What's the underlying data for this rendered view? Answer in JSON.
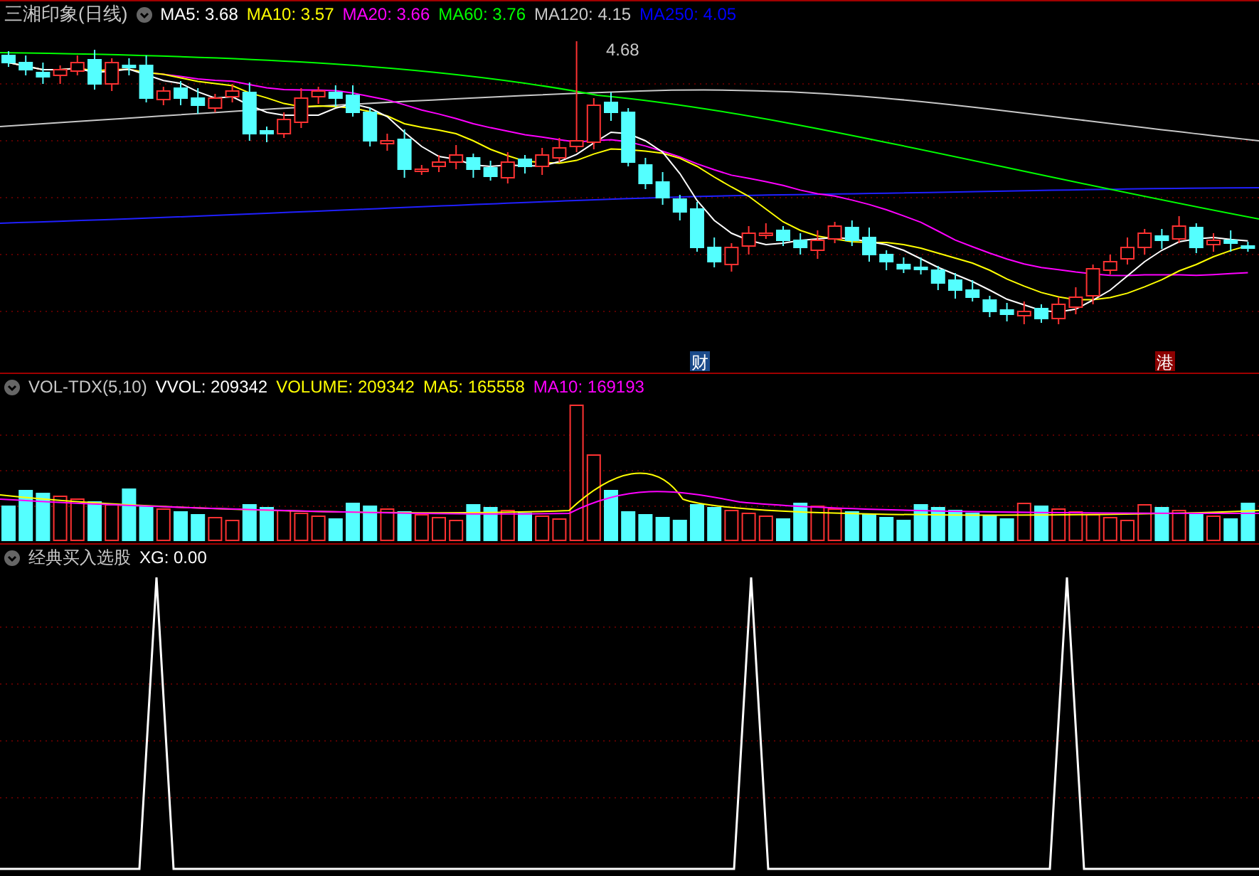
{
  "price_panel": {
    "title": "三湘印象(日线)",
    "indicators": [
      {
        "label": "MA5: 3.68",
        "color": "#ffffff"
      },
      {
        "label": "MA10: 3.57",
        "color": "#ffff00"
      },
      {
        "label": "MA20: 3.66",
        "color": "#ff00ff"
      },
      {
        "label": "MA60: 3.76",
        "color": "#00ff00"
      },
      {
        "label": "MA120: 4.15",
        "color": "#c8c8c8"
      },
      {
        "label": "MA250: 4.05",
        "color": "#0000ff"
      }
    ],
    "high_marker": "4.68",
    "event_badges": [
      {
        "text": "财",
        "color": "#1a4a8a"
      },
      {
        "text": "港",
        "color": "#8b0000"
      }
    ]
  },
  "volume_panel": {
    "title": "VOL-TDX(5,10)",
    "indicators": [
      {
        "label": "VVOL: 209342",
        "color": "#ffffff"
      },
      {
        "label": "VOLUME: 209342",
        "color": "#ffff00"
      },
      {
        "label": "MA5: 165558",
        "color": "#ffff00"
      },
      {
        "label": "MA10: 169193",
        "color": "#ff00ff"
      }
    ]
  },
  "signal_panel": {
    "title": "经典买入选股",
    "indicators": [
      {
        "label": "XG: 0.00",
        "color": "#ffffff"
      }
    ]
  }
}
